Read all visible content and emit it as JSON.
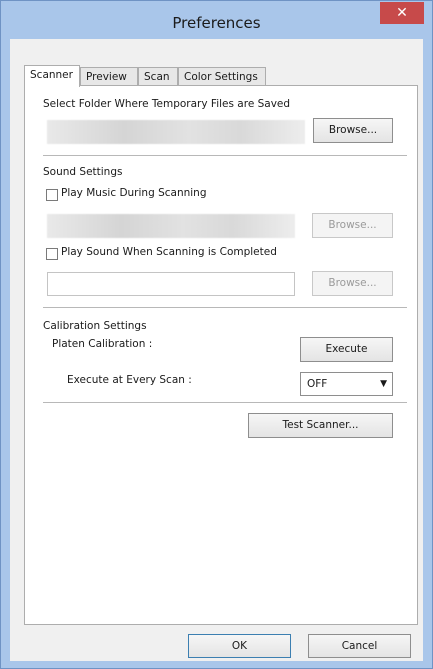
{
  "window": {
    "title": "Preferences",
    "close_glyph": "✕"
  },
  "tabs": [
    "Scanner",
    "Preview",
    "Scan",
    "Color Settings"
  ],
  "temp_folder": {
    "label": "Select Folder Where Temporary Files are Saved",
    "browse_label": "Browse..."
  },
  "sound": {
    "label": "Sound Settings",
    "play_music_label": "Play Music During Scanning",
    "play_music_checked": false,
    "music_browse_label": "Browse...",
    "play_sound_label": "Play Sound When Scanning is Completed",
    "play_sound_checked": false,
    "sound_browse_label": "Browse..."
  },
  "calibration": {
    "label": "Calibration Settings",
    "platen_label": "Platen Calibration :",
    "execute_label": "Execute",
    "every_scan_label": "Execute at Every Scan :",
    "every_scan_value": "OFF"
  },
  "test_scanner_label": "Test Scanner...",
  "footer": {
    "ok_label": "OK",
    "cancel_label": "Cancel"
  }
}
